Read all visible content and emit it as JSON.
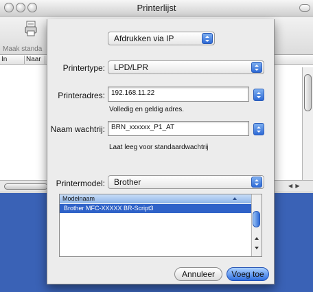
{
  "window": {
    "title": "Printerlijst"
  },
  "toolbar": {
    "make_default_label": "Maak standa"
  },
  "list_columns": [
    {
      "label": "In menu"
    },
    {
      "label": "Naar"
    }
  ],
  "sheet": {
    "connection_popup": "Afdrukken via IP",
    "printer_type": {
      "label": "Printertype:",
      "value": "LPD/LPR"
    },
    "printer_address": {
      "label": "Printeradres:",
      "value": "192.168.11.22",
      "hint": "Volledig en geldig adres."
    },
    "queue_name": {
      "label": "Naam wachtrij:",
      "value": "BRN_xxxxxx_P1_AT",
      "hint": "Laat leeg voor standaardwachtrij"
    },
    "printer_model": {
      "label": "Printermodel:",
      "value": "Brother"
    },
    "model_table": {
      "header": "Modelnaam",
      "rows": [
        "Brother MFC-XXXXX BR-Script3"
      ]
    },
    "buttons": {
      "cancel": "Annuleer",
      "add": "Voeg toe"
    }
  },
  "colors": {
    "accent": "#2f62c8",
    "desktop": "#3a62b6"
  }
}
